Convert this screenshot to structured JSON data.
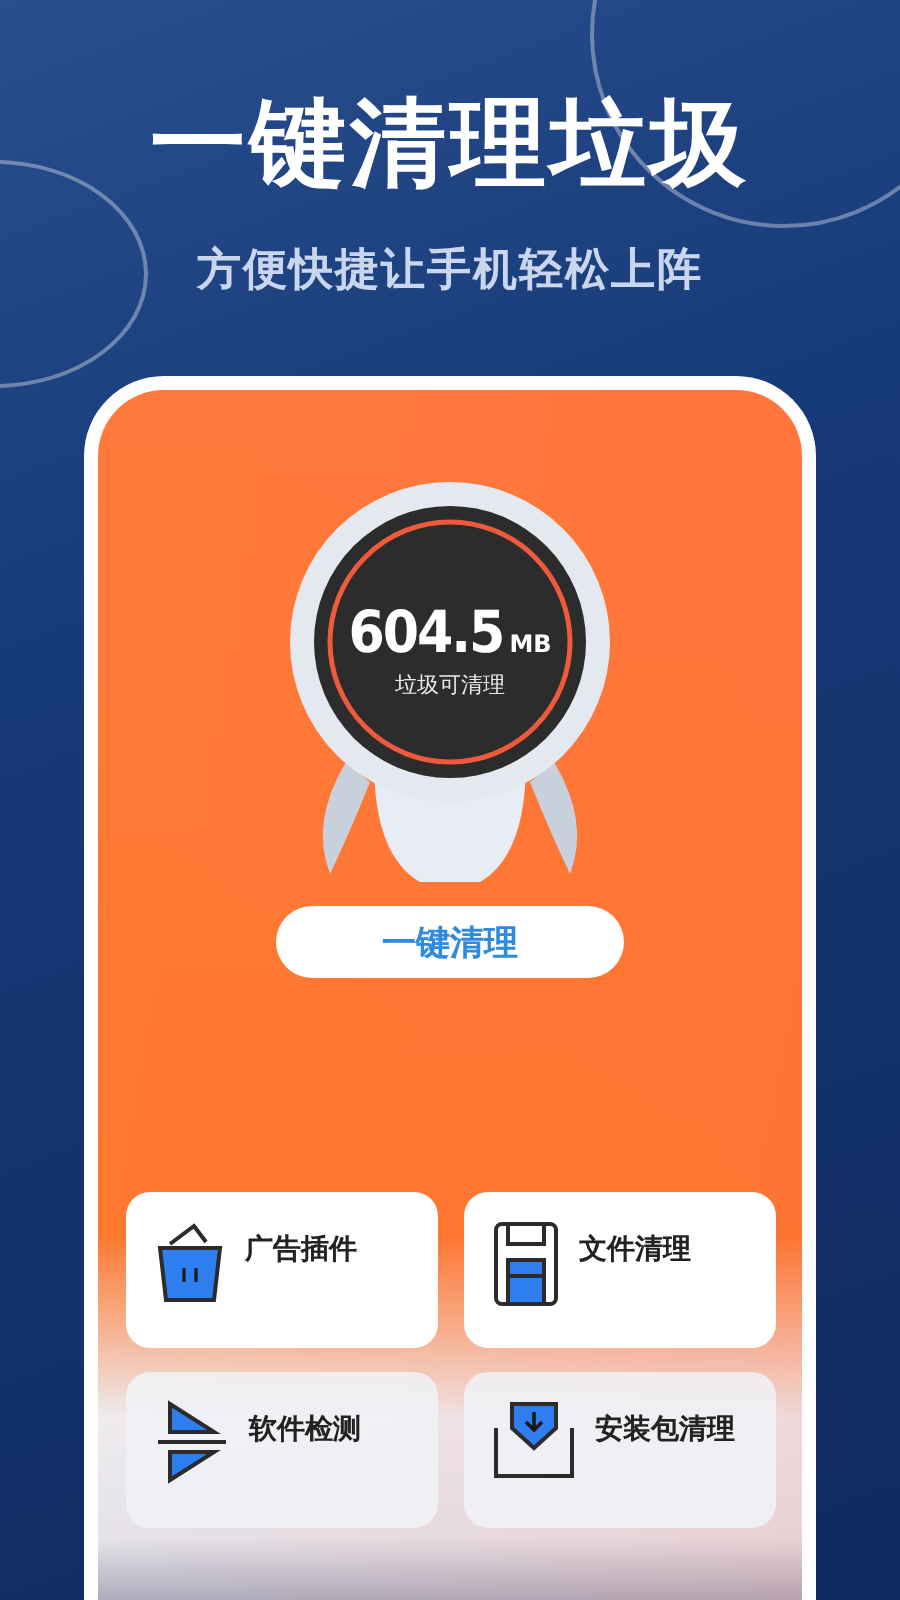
{
  "headline": "一键清理垃圾",
  "subheadline": "方便快捷让手机轻松上阵",
  "cleaner": {
    "amount": "604.5",
    "unit": "MB",
    "caption": "垃圾可清理",
    "button": "一键清理"
  },
  "tools": [
    {
      "label": "广告插件"
    },
    {
      "label": "文件清理"
    },
    {
      "label": "软件检测"
    },
    {
      "label": "安装包清理"
    }
  ]
}
